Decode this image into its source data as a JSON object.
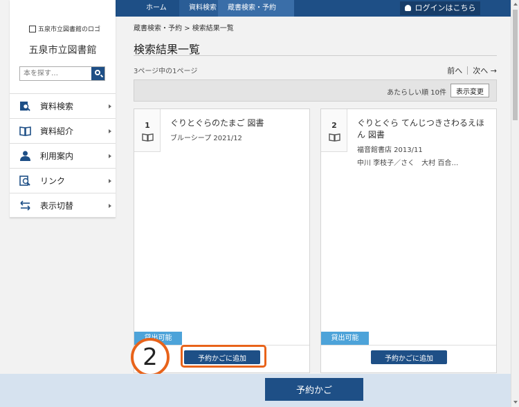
{
  "nav": {
    "crumbs": [
      "ホーム",
      "資料検索",
      "蔵書検索・予約"
    ],
    "login_label": "ログインはこちら"
  },
  "sidebar": {
    "logo_alt": "五泉市立図書館のロゴ",
    "library_name": "五泉市立図書館",
    "search_placeholder": "本を探す…",
    "items": [
      {
        "label": "資料検索",
        "icon": "search-book-icon"
      },
      {
        "label": "資料紹介",
        "icon": "open-book-icon"
      },
      {
        "label": "利用案内",
        "icon": "person-icon"
      },
      {
        "label": "リンク",
        "icon": "link-search-icon"
      },
      {
        "label": "表示切替",
        "icon": "swap-arrows-icon"
      }
    ]
  },
  "main": {
    "breadcrumb": {
      "parent": "蔵書検索・予約",
      "sep": ">",
      "current": "検索結果一覧"
    },
    "title": "検索結果一覧",
    "page_info": "3ページ中の1ページ",
    "pager": {
      "prev": "前へ",
      "next": "次へ →"
    },
    "sort": {
      "text": "あたらしい順 10件",
      "button": "表示変更"
    },
    "results": [
      {
        "num": "1",
        "title": "ぐりとぐらのたまご 図書",
        "meta": [
          "ブルーシープ 2021/12"
        ],
        "status": "貸出可能",
        "add_label": "予約かごに追加"
      },
      {
        "num": "2",
        "title": "ぐりとぐら てんじつきさわるえほん 図書",
        "meta": [
          "福音館書店 2013/11",
          "中川 李枝子／さく　大村 百合…"
        ],
        "status": "貸出可能",
        "add_label": "予約かごに追加"
      }
    ],
    "step_number": "2",
    "cart_label": "予約かご"
  },
  "colors": {
    "primary": "#1e4f86",
    "available": "#4da3d9",
    "highlight": "#e8631a"
  }
}
